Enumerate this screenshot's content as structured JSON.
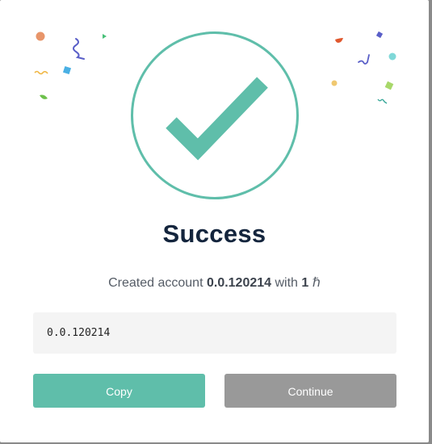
{
  "dialog": {
    "title": "Success",
    "message": {
      "prefix": "Created account ",
      "account_id": "0.0.120214",
      "middle": " with ",
      "amount": "1",
      "unit_symbol": "ℏ"
    },
    "account_field_value": "0.0.120214",
    "copy_label": "Copy",
    "continue_label": "Continue"
  },
  "colors": {
    "accent": "#5fbeaa",
    "title": "#14253d",
    "secondary_button": "#999999"
  },
  "icons": {
    "status": "checkmark-circle-icon",
    "decoration": "confetti"
  }
}
